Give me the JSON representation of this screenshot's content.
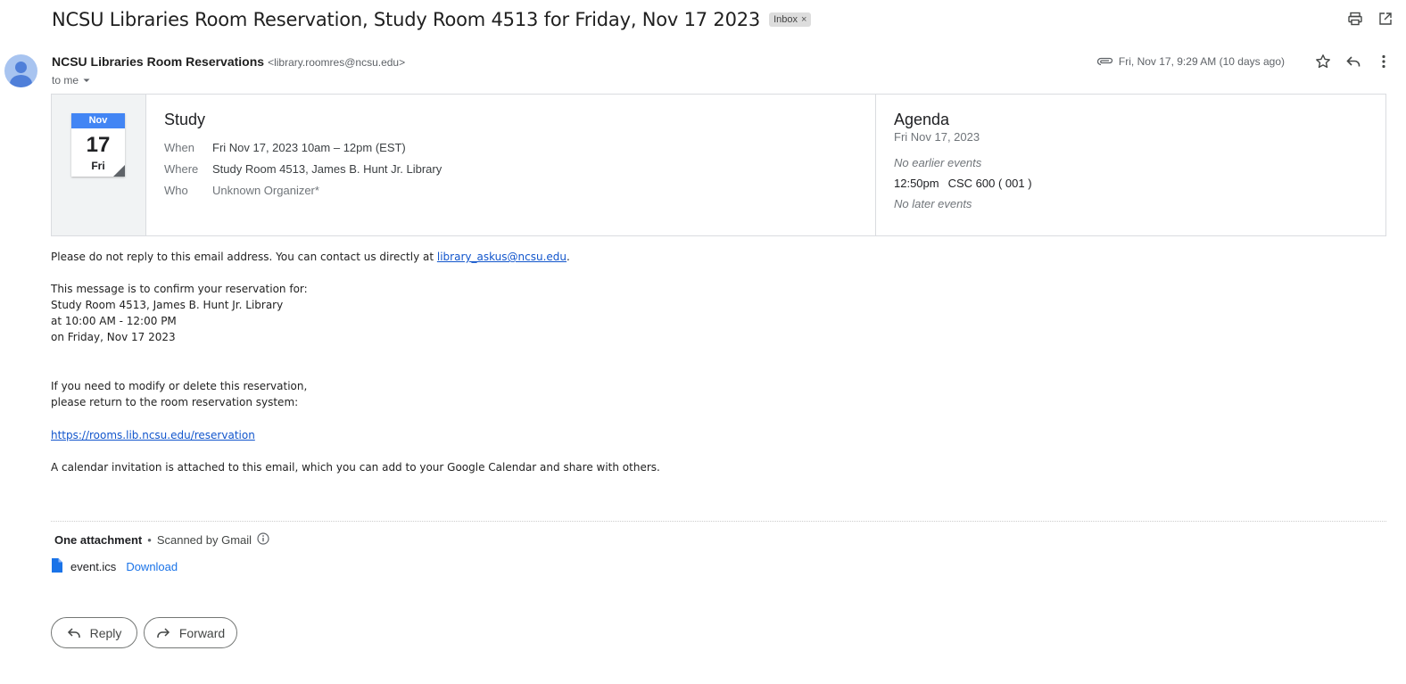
{
  "header": {
    "subject": "NCSU Libraries Room Reservation, Study Room 4513 for Friday, Nov 17 2023",
    "label": "Inbox",
    "label_remove": "×",
    "print_icon": "printer-icon",
    "popout_icon": "open-in-new-window-icon"
  },
  "sender": {
    "name": "NCSU Libraries Room Reservations",
    "email": "<library.roomres@ncsu.edu>",
    "to": "to me",
    "date": "Fri, Nov 17, 9:29 AM (10 days ago)"
  },
  "invite": {
    "cal_month": "Nov",
    "cal_day": "17",
    "cal_dow": "Fri",
    "title": "Study",
    "rows": [
      {
        "label": "When",
        "value": "Fri Nov 17, 2023 10am – 12pm (EST)"
      },
      {
        "label": "Where",
        "value": "Study Room 4513, James B. Hunt Jr. Library"
      },
      {
        "label": "Who",
        "value": "Unknown Organizer*"
      }
    ],
    "agenda": {
      "title": "Agenda",
      "date": "Fri Nov 17, 2023",
      "no_earlier": "No earlier events",
      "event_time": "12:50pm",
      "event_name": "CSC 600 ( 001 )",
      "no_later": "No later events"
    }
  },
  "body": {
    "line1_prefix": "Please do not reply to this email address. You can contact us directly at ",
    "line1_link": "library_askus@ncsu.edu",
    "line1_suffix": ".",
    "confirm": "This message is to confirm your reservation for:",
    "room": "Study Room 4513, James B. Hunt Jr. Library",
    "time": "at 10:00 AM - 12:00 PM",
    "date": "on Friday, Nov 17 2023",
    "modify1": "If you need to modify or delete this reservation,",
    "modify2": "please return to the room reservation system:",
    "url": "https://rooms.lib.ncsu.edu/reservation",
    "calendar_note": "A calendar invitation is attached to this email, which you can add to your Google Calendar and share with others."
  },
  "attachment": {
    "count_label": "One attachment",
    "separator": "•",
    "scanned": "Scanned by Gmail",
    "filename": "event.ics",
    "download": "Download"
  },
  "actions": {
    "reply": "Reply",
    "forward": "Forward"
  },
  "colors": {
    "accent": "#1a73e8",
    "link": "#1155cc",
    "calendar_blue": "#4285f4",
    "avatar_bg": "#a8c4f0"
  }
}
